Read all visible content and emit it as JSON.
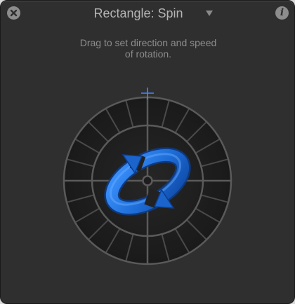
{
  "header": {
    "title": "Rectangle: Spin",
    "close_icon": "close-icon",
    "info_glyph": "i",
    "info_icon": "info-icon",
    "dropdown_icon": "chevron-down-icon"
  },
  "hint": {
    "line1": "Drag to set direction and speed",
    "line2": "of rotation."
  },
  "dial": {
    "crosshair_icon": "crosshair-icon",
    "spin_icon": "rotation-arrow-icon",
    "accent_color": "#2f7fe8",
    "crosshair_color": "#3d8cff",
    "ring_color": "#5a5a5a",
    "face_color": "#1d1d1d"
  }
}
